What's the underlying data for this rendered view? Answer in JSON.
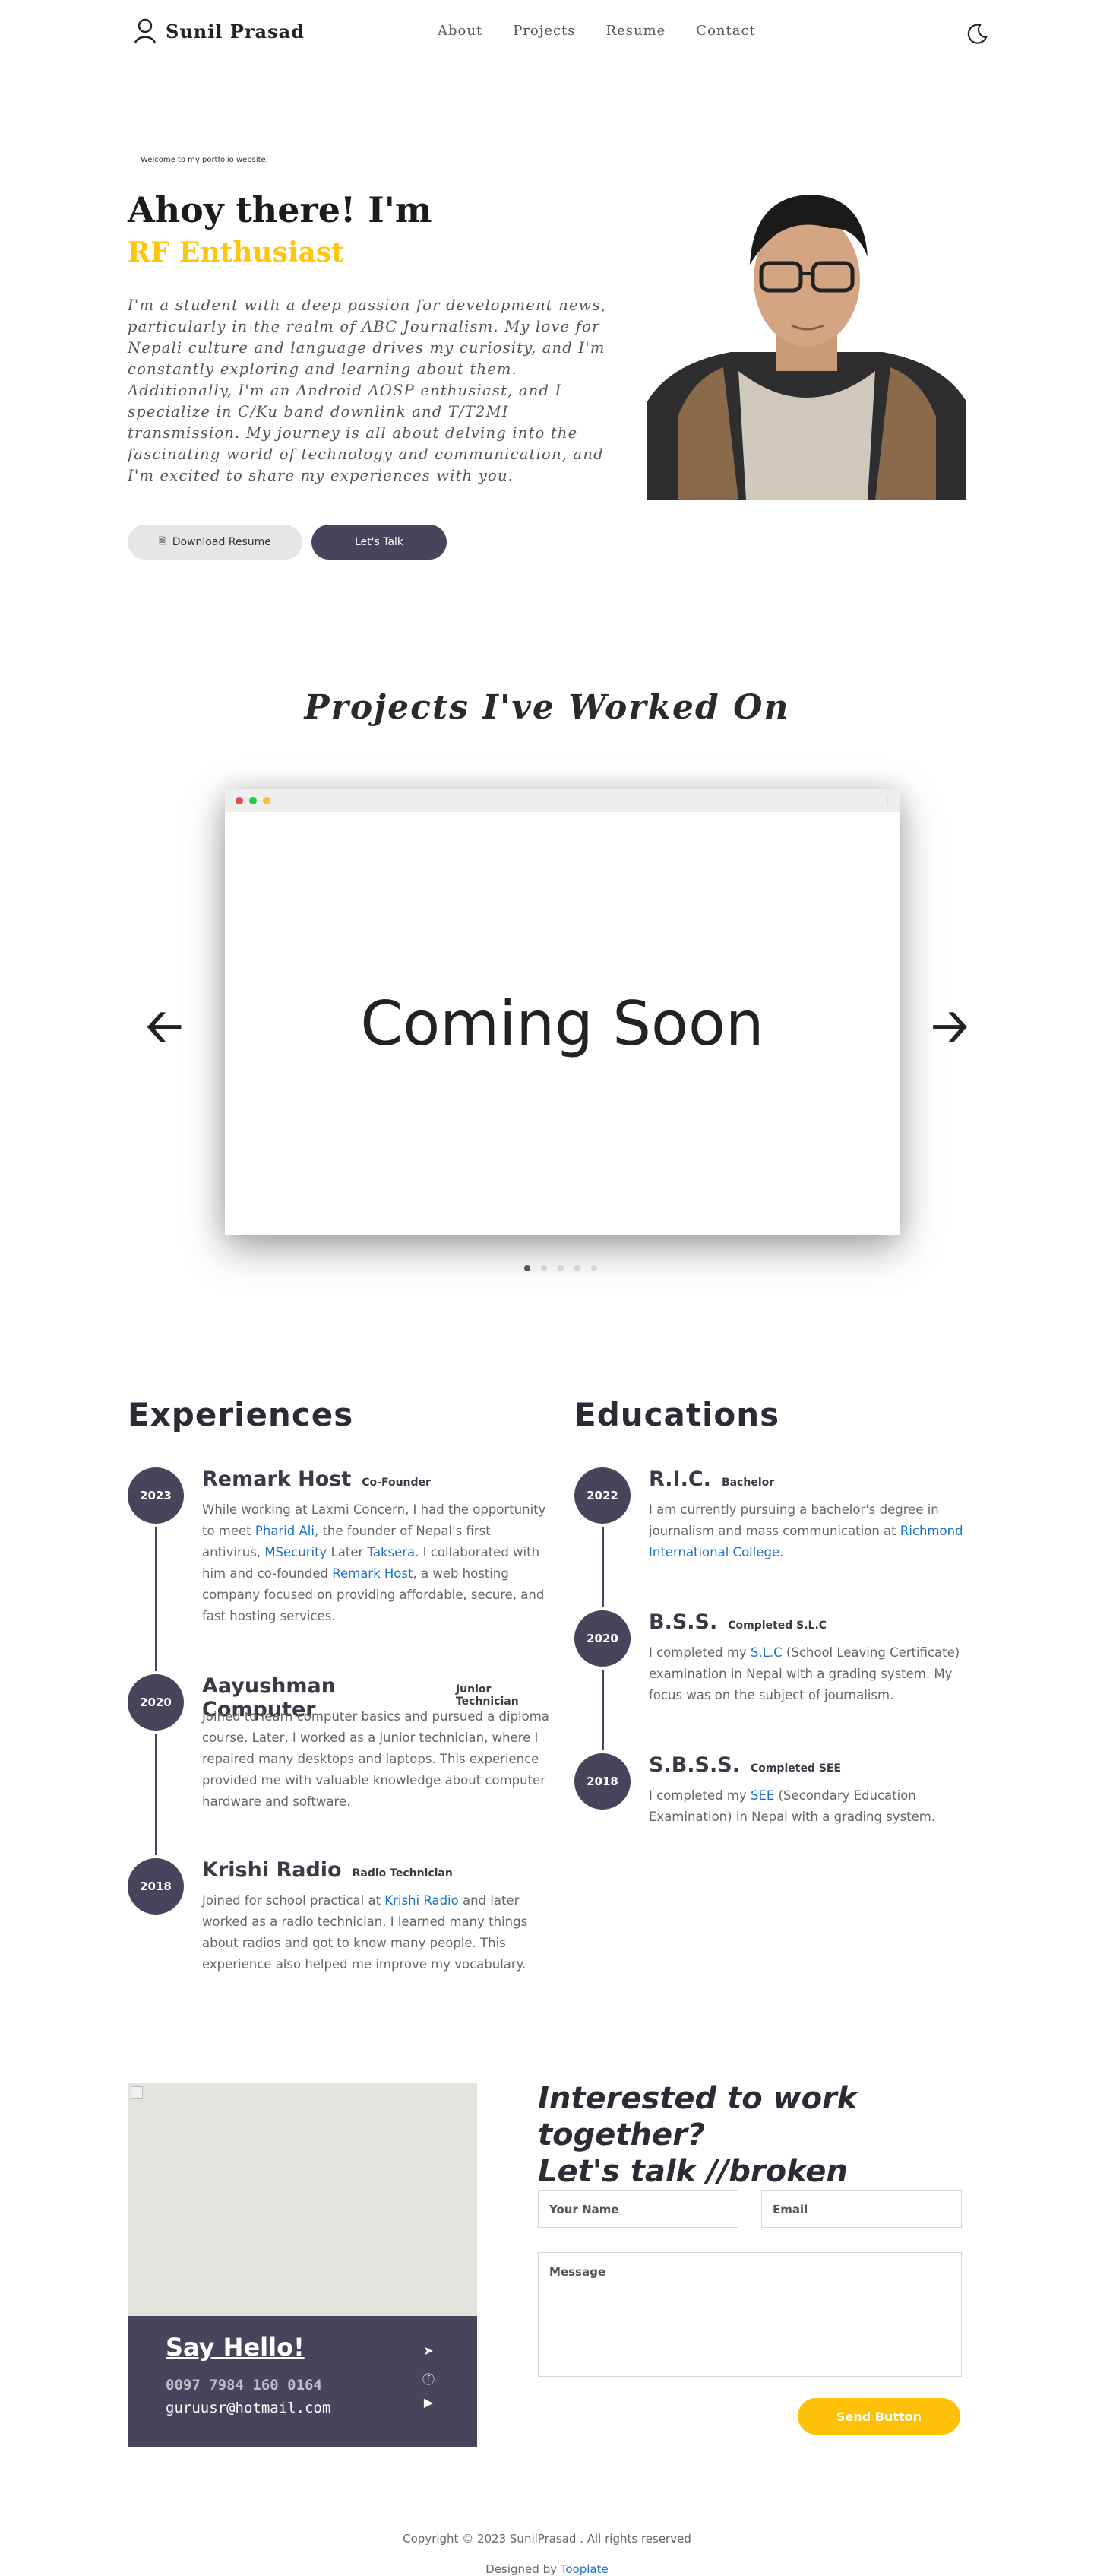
{
  "nav": {
    "brand": "Sunil Prasad",
    "links": [
      "About",
      "Projects",
      "Resume",
      "Contact"
    ]
  },
  "hero": {
    "welcome": "Welcome to my portfolio website;",
    "greeting": "Ahoy there! I'm",
    "role": "RF Enthusiast",
    "description": "I'm a student with a deep passion for development news, particularly in the realm of ABC Journalism. My love for Nepali culture and language drives my curiosity, and I'm constantly exploring and learning about them. Additionally, I'm an Android AOSP enthusiast, and I specialize in C/Ku band downlink and T/T2MI transmission. My journey is all about delving into the fascinating world of technology and communication, and I'm excited to share my experiences with you.",
    "btn_resume": "Download Resume",
    "btn_talk": "Let's Talk"
  },
  "projects": {
    "title": "Projects I've Worked On",
    "slide_text": "Coming Soon",
    "arrow_left": "🡠",
    "arrow_right": "🡢",
    "slide_count": 5,
    "active_slide": 1
  },
  "experiences": {
    "title": "Experiences",
    "items": [
      {
        "year": "2023",
        "name": "Remark Host",
        "role": "Co-Founder",
        "parts": [
          "While working at Laxmi Concern, I had the opportunity to meet ",
          "Pharid Ali",
          ", the founder of Nepal's first antivirus, ",
          "MSecurity",
          " Later ",
          "Taksera",
          ". I collaborated with him and co-founded ",
          "Remark Host",
          ", a web hosting company focused on providing affordable, secure, and fast hosting services."
        ]
      },
      {
        "year": "2020",
        "name": "Aayushman Computer",
        "role": "Junior Technician",
        "desc": "Joined to learn computer basics and pursued a diploma course. Later, I worked as a junior technician, where I repaired many desktops and laptops. This experience provided me with valuable knowledge about computer hardware and software."
      },
      {
        "year": "2018",
        "name": "Krishi Radio",
        "role": "Radio Technician",
        "parts": [
          "Joined for school practical at ",
          "Krishi Radio",
          " and later worked as a radio technician. I learned many things about radios and got to know many people. This experience also helped me improve my vocabulary."
        ]
      }
    ]
  },
  "educations": {
    "title": "Educations",
    "items": [
      {
        "year": "2022",
        "name": "R.I.C.",
        "role": "Bachelor",
        "parts": [
          "I am currently pursuing a bachelor's degree in journalism and mass communication at ",
          "Richmond International College",
          "."
        ]
      },
      {
        "year": "2020",
        "name": "B.S.S.",
        "role": "Completed S.L.C",
        "parts": [
          "I completed my ",
          "S.L.C",
          " (School Leaving Certificate) examination in Nepal with a grading system. My focus was on the subject of journalism."
        ]
      },
      {
        "year": "2018",
        "name": "S.B.S.S.",
        "role": "Completed SEE",
        "parts": [
          "I completed my ",
          "SEE",
          " (Secondary Education Examination) in Nepal with a grading system."
        ]
      }
    ]
  },
  "contact": {
    "say_hello": "Say Hello!",
    "phone": "0097 7984 160 0164",
    "email": "guruusr@hotmail.com",
    "cta_line1": "Interested to work together?",
    "cta_line2": "Let's talk //broken",
    "name_placeholder": "Your Name",
    "email_placeholder": "Email",
    "message_placeholder": "Message",
    "send": "Send Button"
  },
  "footer": {
    "copyright": "Copyright © 2023 SunilPrasad . All rights reserved",
    "designed_by": "Designed by",
    "designer": "Tooplate"
  },
  "colors": {
    "accent": "#ffc40e",
    "dark": "#46455b",
    "link": "#1a73c8"
  }
}
